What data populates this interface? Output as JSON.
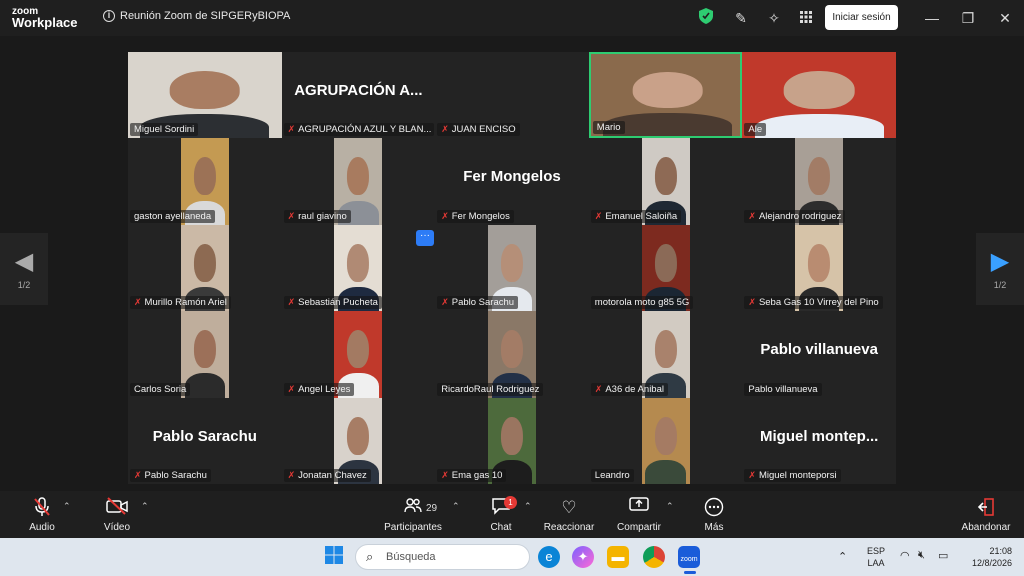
{
  "titlebar": {
    "brand_line1": "zoom",
    "brand_line2": "Workplace",
    "meeting_title": "Reunión Zoom de SIPGERyBIOPA",
    "signin_label": "Iniciar sesión"
  },
  "stage": {
    "page_left": "1/2",
    "page_right": "1/2"
  },
  "participants": [
    {
      "name": "Miguel Sordini",
      "muted": false,
      "video": true,
      "active": false,
      "bg": "#d9d4cc",
      "skin": "#a97d62",
      "shirt": "#2c2f33"
    },
    {
      "name": "AGRUPACIÓN AZUL Y BLAN...",
      "display": "AGRUPACIÓN  A...",
      "muted": true,
      "video": false,
      "active": false
    },
    {
      "name": "JUAN ENCISO",
      "muted": true,
      "video": false,
      "active": false,
      "display": ""
    },
    {
      "name": "Mario",
      "muted": false,
      "video": true,
      "active": true,
      "bg": "#8a6a4c",
      "skin": "#c9a189",
      "shirt": "#4a3a30"
    },
    {
      "name": "Ale",
      "muted": false,
      "video": true,
      "active": false,
      "bg": "#c0392b",
      "skin": "#c7a28a",
      "shirt": "#e8eef6"
    },
    {
      "name": "gaston ayellaneda",
      "muted": false,
      "video": true,
      "active": false,
      "bg": "#c49a52",
      "skin": "#9c7256",
      "shirt": "#d9d9d9"
    },
    {
      "name": "raul giavino",
      "muted": true,
      "video": true,
      "active": false,
      "bg": "#b8b0a4",
      "skin": "#a87b5f",
      "shirt": "#8c9097"
    },
    {
      "name": "Fer Mongelos",
      "display": "Fer Mongelos",
      "muted": true,
      "video": false,
      "active": false
    },
    {
      "name": "Emanuel Saloiña",
      "muted": true,
      "video": true,
      "active": false,
      "bg": "#cfcac4",
      "skin": "#8e6a55",
      "shirt": "#1f2833"
    },
    {
      "name": "Alejandro rodriguez",
      "muted": true,
      "video": true,
      "active": false,
      "bg": "#a89f96",
      "skin": "#a27c66",
      "shirt": "#2d2d2d"
    },
    {
      "name": "Murillo Ramón Ariel",
      "muted": true,
      "video": true,
      "active": false,
      "bg": "#cbb9a6",
      "skin": "#8d6a52",
      "shirt": "#3a3a3a"
    },
    {
      "name": "Sebastián Pucheta",
      "muted": true,
      "video": true,
      "active": false,
      "bg": "#e4ddd3",
      "skin": "#b08a74",
      "shirt": "#1e2a40"
    },
    {
      "name": "Pablo Sarachu",
      "muted": true,
      "video": true,
      "active": false,
      "bg": "#a39e99",
      "skin": "#b58f78",
      "shirt": "#e5e9ee"
    },
    {
      "name": "motorola moto g85 5G",
      "muted": false,
      "video": true,
      "active": false,
      "bg": "#7d2a1f",
      "skin": "#8b6a57",
      "shirt": "#1b2633"
    },
    {
      "name": "Seba Gas 10 Virrey del Pino",
      "muted": true,
      "video": true,
      "active": false,
      "bg": "#d6c3a8",
      "skin": "#b98c71",
      "shirt": "#2a2a2a"
    },
    {
      "name": "Carlos Soria",
      "muted": false,
      "video": true,
      "active": false,
      "bg": "#bfae9c",
      "skin": "#9c7059",
      "shirt": "#2b2b2b"
    },
    {
      "name": "Angel Leyes",
      "muted": true,
      "video": true,
      "active": false,
      "bg": "#c0392b",
      "skin": "#a37a62",
      "shirt": "#f0f0f0"
    },
    {
      "name": "RicardoRaul Rodriguez",
      "muted": false,
      "video": true,
      "active": false,
      "bg": "#8a7867",
      "skin": "#a37c66",
      "shirt": "#223047"
    },
    {
      "name": "A36 de Anibal",
      "muted": true,
      "video": true,
      "active": false,
      "bg": "#d2cbc2",
      "skin": "#a9826c",
      "shirt": "#2f3a44"
    },
    {
      "name": "Pablo villanueva",
      "display": "Pablo villanueva",
      "muted": false,
      "video": false,
      "active": false
    },
    {
      "name": "Pablo Sarachu",
      "display": "Pablo Sarachu",
      "muted": true,
      "video": false,
      "active": false
    },
    {
      "name": "Jonatan Chavez",
      "muted": true,
      "video": true,
      "active": false,
      "bg": "#d8d2cb",
      "skin": "#a77d65",
      "shirt": "#2c3440"
    },
    {
      "name": "Ema gas 10",
      "muted": true,
      "video": true,
      "active": false,
      "bg": "#4d6a3c",
      "skin": "#9a7560",
      "shirt": "#1d1d1d"
    },
    {
      "name": "Leandro",
      "muted": false,
      "video": true,
      "active": false,
      "bg": "#b58a4f",
      "skin": "#a57b63",
      "shirt": "#3a4a3a"
    },
    {
      "name": "Miguel monteporsi",
      "display": "Miguel  montep...",
      "muted": true,
      "video": false,
      "active": false
    }
  ],
  "toolbar": {
    "audio_label": "Audio",
    "video_label": "Vídeo",
    "participants_label": "Participantes",
    "participants_count": "29",
    "chat_label": "Chat",
    "chat_badge": "1",
    "react_label": "Reaccionar",
    "share_label": "Compartir",
    "more_label": "Más",
    "leave_label": "Abandonar"
  },
  "taskbar": {
    "search_placeholder": "Búsqueda",
    "lang_line1": "ESP",
    "lang_line2": "LAA",
    "time": "21:08",
    "date": "12/8/2026"
  },
  "colors": {
    "active_speaker": "#2ecc71",
    "muted": "#e53935",
    "accent": "#2d7cf6"
  }
}
